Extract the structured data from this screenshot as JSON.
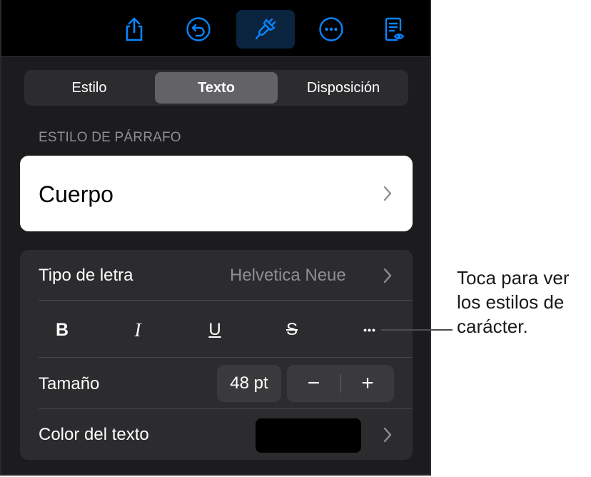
{
  "toolbar": {
    "icons": [
      "share-icon",
      "undo-icon",
      "paintbrush-icon",
      "more-icon",
      "reading-view-icon"
    ],
    "accent": "#0a84ff"
  },
  "tabs": [
    {
      "label": "Estilo",
      "active": false
    },
    {
      "label": "Texto",
      "active": true
    },
    {
      "label": "Disposición",
      "active": false
    }
  ],
  "paragraph_style": {
    "header": "ESTILO DE PÁRRAFO",
    "value": "Cuerpo"
  },
  "font": {
    "label": "Tipo de letra",
    "value": "Helvetica Neue"
  },
  "format_buttons": [
    {
      "name": "bold",
      "glyph": "B"
    },
    {
      "name": "italic",
      "glyph": "I"
    },
    {
      "name": "underline",
      "glyph": "U"
    },
    {
      "name": "strikethrough",
      "glyph": "S"
    },
    {
      "name": "more-character-styles",
      "glyph": "•••"
    }
  ],
  "size": {
    "label": "Tamaño",
    "value": "48 pt",
    "minus": "−",
    "plus": "+"
  },
  "text_color": {
    "label": "Color del texto",
    "swatch": "#000000"
  },
  "callout": {
    "text": "Toca para ver los estilos de carácter."
  }
}
